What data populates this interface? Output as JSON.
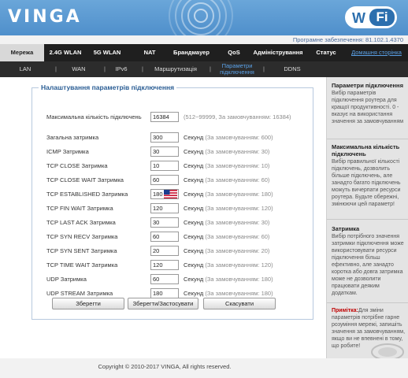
{
  "header": {
    "brand": "VINGA",
    "wifi_w": "W",
    "wifi_fi": "Fi"
  },
  "firmware": "Програмне забезпечення: 81.102.1.4370",
  "topnav": [
    {
      "label": "Мережа"
    },
    {
      "label": "2.4G WLAN"
    },
    {
      "label": "5G WLAN"
    },
    {
      "label": "NAT"
    },
    {
      "label": "Брандмауер"
    },
    {
      "label": "QoS"
    },
    {
      "label": "Адміністрування"
    },
    {
      "label": "Статус"
    },
    {
      "label": "Домашня сторінка"
    }
  ],
  "subnav": [
    {
      "label": "LAN"
    },
    {
      "label": "WAN"
    },
    {
      "label": "IPv6"
    },
    {
      "label": "Маршрутизація"
    },
    {
      "label": "Параметри підключення"
    },
    {
      "label": "DDNS"
    }
  ],
  "panel": {
    "title": "Налаштування параметрів підключення",
    "rows": [
      {
        "label": "Максимальна кількість підключень",
        "value": "16384",
        "unit": "",
        "hint": "(512~99999, За замовчуванням: 16384)"
      },
      {
        "label": "Загальна затримка",
        "value": "300",
        "unit": "Секунд",
        "hint": "(За замовчуванням: 600)"
      },
      {
        "label": "ICMP Затримка",
        "value": "30",
        "unit": "Секунд",
        "hint": "(За замовчуванням: 30)"
      },
      {
        "label": "TCP CLOSE Затримка",
        "value": "10",
        "unit": "Секунд",
        "hint": "(За замовчуванням: 10)"
      },
      {
        "label": "TCP CLOSE WAIT Затримка",
        "value": "60",
        "unit": "Секунд",
        "hint": "(За замовчуванням: 60)"
      },
      {
        "label": "TCP ESTABLISHED Затримка",
        "value": "180",
        "unit": "Секунд",
        "hint": "(За замовчуванням: 180)"
      },
      {
        "label": "TCP FIN WAIT Затримка",
        "value": "120",
        "unit": "Секунд",
        "hint": "(За замовчуванням: 120)"
      },
      {
        "label": "TCP LAST ACK Затримка",
        "value": "30",
        "unit": "Секунд",
        "hint": "(За замовчуванням: 30)"
      },
      {
        "label": "TCP SYN RECV Затримка",
        "value": "60",
        "unit": "Секунд",
        "hint": "(За замовчуванням: 60)"
      },
      {
        "label": "TCP SYN SENT Затримка",
        "value": "20",
        "unit": "Секунд",
        "hint": "(За замовчуванням: 20)"
      },
      {
        "label": "TCP TIME WAIT Затримка",
        "value": "120",
        "unit": "Секунд",
        "hint": "(За замовчуванням: 120)"
      },
      {
        "label": "UDP Затримка",
        "value": "60",
        "unit": "Секунд",
        "hint": "(За замовчуванням: 180)"
      },
      {
        "label": "UDP STREAM Затримка",
        "value": "180",
        "unit": "Секунд",
        "hint": "(За замовчуванням: 180)"
      }
    ]
  },
  "buttons": {
    "save": "Зберегти",
    "save_apply": "Зберегти/Застосувати",
    "cancel": "Скасувати"
  },
  "help": {
    "sections": [
      {
        "title": "Параметри підключення",
        "text": "Вибір параметрів підключення роутера для кращої продуктивності. 0 - вказує на використання значення за замовчуванням"
      },
      {
        "title": "Максимальна кількість підключень",
        "text": "Вибір правильної кількості підключень, дозволить більше підключень, але занадто багато підключень можуть вичерпати ресурси роутера. Будьте обережні, змінюючи цей параметр!"
      },
      {
        "title": "Затримка",
        "text": "Вибір потрібного значення затримки підключення може використовувати ресурси підключення більш ефективно, але занадто коротка або довга затримка може не дозволити працювати деяким додаткам."
      }
    ],
    "note_label": "Примітка:",
    "note_text": "Для зміни параметрів потрібне гарне розуміння мережі, запишіть значення за замовчуванням, якщо ви не впевнені в тому, що робите!"
  },
  "footer": "Copyright © 2010-2017 VINGA, All rights reserved.",
  "colors": {
    "header_blue": "#4f8fcb",
    "nav_dark": "#1f1f1f",
    "link_blue": "#5aa0e6",
    "note_red": "#c00000"
  }
}
